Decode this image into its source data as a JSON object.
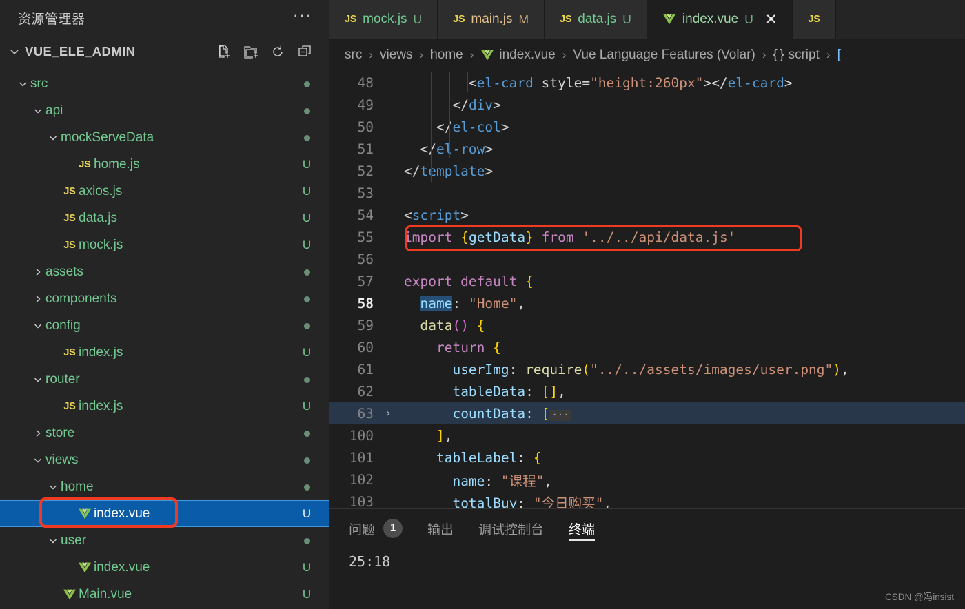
{
  "sidebar": {
    "title": "资源管理器",
    "more_label": "···",
    "root_label": "VUE_ELE_ADMIN",
    "actions": [
      {
        "name": "new-file-icon",
        "label": "新建文件"
      },
      {
        "name": "new-folder-icon",
        "label": "新建文件夹"
      },
      {
        "name": "refresh-icon",
        "label": "刷新资源管理器"
      },
      {
        "name": "collapse-all-icon",
        "label": "在资源管理器中折叠文件夹"
      }
    ],
    "tree": [
      {
        "label": "src",
        "indent": 0,
        "type": "folder",
        "expanded": true,
        "status": "dot",
        "selected": false
      },
      {
        "label": "api",
        "indent": 1,
        "type": "folder",
        "expanded": true,
        "status": "dot",
        "selected": false
      },
      {
        "label": "mockServeData",
        "indent": 2,
        "type": "folder",
        "expanded": true,
        "status": "dot",
        "selected": false
      },
      {
        "label": "home.js",
        "indent": 3,
        "type": "js",
        "expanded": null,
        "status": "U",
        "selected": false
      },
      {
        "label": "axios.js",
        "indent": 2,
        "type": "js",
        "expanded": null,
        "status": "U",
        "selected": false
      },
      {
        "label": "data.js",
        "indent": 2,
        "type": "js",
        "expanded": null,
        "status": "U",
        "selected": false
      },
      {
        "label": "mock.js",
        "indent": 2,
        "type": "js",
        "expanded": null,
        "status": "U",
        "selected": false
      },
      {
        "label": "assets",
        "indent": 1,
        "type": "folder",
        "expanded": false,
        "status": "dot",
        "selected": false
      },
      {
        "label": "components",
        "indent": 1,
        "type": "folder",
        "expanded": false,
        "status": "dot",
        "selected": false
      },
      {
        "label": "config",
        "indent": 1,
        "type": "folder",
        "expanded": true,
        "status": "dot",
        "selected": false
      },
      {
        "label": "index.js",
        "indent": 2,
        "type": "js",
        "expanded": null,
        "status": "U",
        "selected": false
      },
      {
        "label": "router",
        "indent": 1,
        "type": "folder",
        "expanded": true,
        "status": "dot",
        "selected": false
      },
      {
        "label": "index.js",
        "indent": 2,
        "type": "js",
        "expanded": null,
        "status": "U",
        "selected": false
      },
      {
        "label": "store",
        "indent": 1,
        "type": "folder",
        "expanded": false,
        "status": "dot",
        "selected": false
      },
      {
        "label": "views",
        "indent": 1,
        "type": "folder",
        "expanded": true,
        "status": "dot",
        "selected": false
      },
      {
        "label": "home",
        "indent": 2,
        "type": "folder",
        "expanded": true,
        "status": "dot",
        "selected": false
      },
      {
        "label": "index.vue",
        "indent": 3,
        "type": "vue",
        "expanded": null,
        "status": "U",
        "selected": true
      },
      {
        "label": "user",
        "indent": 2,
        "type": "folder",
        "expanded": true,
        "status": "dot",
        "selected": false
      },
      {
        "label": "index.vue",
        "indent": 3,
        "type": "vue",
        "expanded": null,
        "status": "U",
        "selected": false
      },
      {
        "label": "Main.vue",
        "indent": 2,
        "type": "vue",
        "expanded": null,
        "status": "U",
        "selected": false
      }
    ]
  },
  "tabs": [
    {
      "name": "mock.js",
      "icon": "js",
      "status": "U",
      "active": false,
      "closable": false
    },
    {
      "name": "main.js",
      "icon": "js",
      "status": "M",
      "active": false,
      "closable": false
    },
    {
      "name": "data.js",
      "icon": "js",
      "status": "U",
      "active": false,
      "closable": false
    },
    {
      "name": "index.vue",
      "icon": "vue",
      "status": "U",
      "active": true,
      "closable": true,
      "close_label": "✕"
    },
    {
      "name": "",
      "icon": "js",
      "status": "",
      "active": false,
      "closable": false
    }
  ],
  "breadcrumb": {
    "items": [
      "src",
      "views",
      "home",
      "index.vue",
      "Vue Language Features (Volar)",
      "script"
    ],
    "separator": "›",
    "script_brace": "{ }"
  },
  "editor": {
    "lines": [
      {
        "num": "48",
        "text": "        <el-card style=\"height:260px\"></el-card>"
      },
      {
        "num": "49",
        "text": "      </div>"
      },
      {
        "num": "50",
        "text": "    </el-col>"
      },
      {
        "num": "51",
        "text": "  </el-row>"
      },
      {
        "num": "52",
        "text": "</template>"
      },
      {
        "num": "53",
        "text": ""
      },
      {
        "num": "54",
        "text": "<script>"
      },
      {
        "num": "55",
        "text": "import {getData} from '../../api/data.js'"
      },
      {
        "num": "56",
        "text": ""
      },
      {
        "num": "57",
        "text": "export default {"
      },
      {
        "num": "58",
        "text": "  name: \"Home\","
      },
      {
        "num": "59",
        "text": "  data() {"
      },
      {
        "num": "60",
        "text": "    return {"
      },
      {
        "num": "61",
        "text": "      userImg: require(\"../../assets/images/user.png\"),"
      },
      {
        "num": "62",
        "text": "      tableData: [],"
      },
      {
        "num": "63",
        "text": "      countData: [ ···"
      },
      {
        "num": "100",
        "text": "    ],"
      },
      {
        "num": "101",
        "text": "    tableLabel: {"
      },
      {
        "num": "102",
        "text": "      name: \"课程\","
      },
      {
        "num": "103",
        "text": "      totalBuy: \"今日购买\","
      }
    ],
    "active_line": "58",
    "folded_line": "63",
    "fold_chevron": "›",
    "selection_text": "name",
    "highlight_box_line": "55"
  },
  "panel": {
    "tabs": [
      {
        "label": "问题",
        "badge": "1",
        "active": false
      },
      {
        "label": "输出",
        "badge": "",
        "active": false
      },
      {
        "label": "调试控制台",
        "badge": "",
        "active": false
      },
      {
        "label": "终端",
        "badge": "",
        "active": true
      }
    ],
    "terminal_output": "25:18"
  },
  "watermark": "CSDN @冯insist",
  "colors": {
    "accent_selection": "#0a5ca8",
    "annotation_red": "#f03a21",
    "git_green": "#73c991",
    "git_modified": "#e2c08d"
  }
}
